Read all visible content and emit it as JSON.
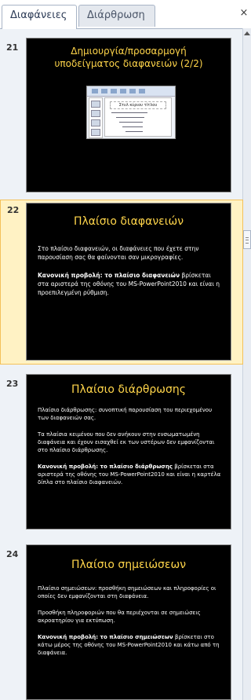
{
  "tabs": {
    "slides": "Διαφάνειες",
    "outline": "Διάρθρωση"
  },
  "close_glyph": "×",
  "slides": [
    {
      "number": "21",
      "title": "Δημιουργία/προσαρμογή υποδείγματος διαφανειών (2/2)",
      "mini_title": "Στυλ κύριου τίτλου"
    },
    {
      "number": "22",
      "title": "Πλαίσιο διαφανειών",
      "p1": "Στο πλαίσιο διαφανειών, οι διαφάνειες που έχετε στην παρουσίαση σας θα φαίνονται σαν μικρογραφίες.",
      "p2_bold": "Κανονική προβολή: το πλαίσιο διαφανειών",
      "p2_rest": " βρίσκεται στα αριστερά της οθόνης του MS-PowerPoint2010 και είναι η προεπιλεγμένη ρύθμιση."
    },
    {
      "number": "23",
      "title": "Πλαίσιο διάρθρωσης",
      "p1": "Πλαίσιο διάρθρωσης: συνοπτική παρουσίαση του περιεχομένου των διαφανειών σας.",
      "p2": "Τα πλαίσια κειμένου που δεν ανήκουν στην ενσωματωμένη διαφάνεια και έχουν εισαχθεί εκ των υστέρων δεν εμφανίζονται στο πλαίσιο διάρθρωσης.",
      "p3_bold": "Κανονική προβολή: το πλαίσιο διάρθρωσης",
      "p3_rest": " βρίσκεται στα αριστερά της οθόνης του MS-PowerPoint2010 και είναι η καρτέλα δίπλα στο πλαίσιο διαφανειών."
    },
    {
      "number": "24",
      "title": "Πλαίσιο σημειώσεων",
      "p1": "Πλαίσιο σημειώσεων: προσθήκη σημειώσεων και πληροφορίες οι οποίες δεν εμφανίζονται στη διαφάνεια.",
      "p2": "Προσθήκη πληροφοριών που θα περιέχονται σε σημειώσεις ακροατηρίου για εκτύπωση.",
      "p3_bold": "Κανονική προβολή: το πλαίσιο σημειώσεων",
      "p3_rest": " βρίσκεται στο κάτω μέρος της οθόνης του MS-PowerPoint2010 και κάτω από τη διαφάνεια."
    }
  ],
  "colors": {
    "title": "#ffd54a",
    "selection": "#fff2c4",
    "selection_border": "#f4c15a"
  }
}
